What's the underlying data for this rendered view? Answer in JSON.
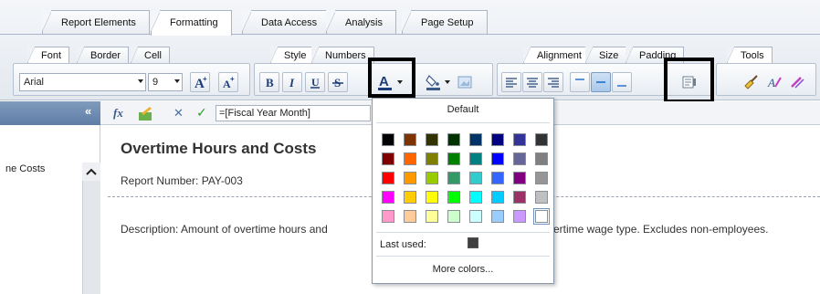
{
  "top_tabs": [
    {
      "label": "Report Elements"
    },
    {
      "label": "Formatting"
    },
    {
      "label": "Data Access"
    },
    {
      "label": "Analysis"
    },
    {
      "label": "Page Setup"
    }
  ],
  "sub_tabs": {
    "font": "Font",
    "border": "Border",
    "cell": "Cell",
    "style": "Style",
    "numbers": "Numbers",
    "alignment": "Alignment",
    "size": "Size",
    "padding": "Padding",
    "tools": "Tools"
  },
  "font_toolbar": {
    "font_name": "Arial",
    "font_size": "9"
  },
  "formula_bar": {
    "value": "=[Fiscal Year Month]"
  },
  "left_panel": {
    "item": "ne Costs"
  },
  "report": {
    "title": "Overtime Hours and Costs",
    "number": "Report Number: PAY-003",
    "description_start": "Description: Amount of overtime hours and",
    "description_end": "ertime wage type. Excludes non-employees."
  },
  "color_popup": {
    "default_label": "Default",
    "last_used_label": "Last used:",
    "more_colors_label": "More colors...",
    "swatch_rows": [
      [
        "#000000",
        "#7f3300",
        "#333300",
        "#003300",
        "#003366",
        "#000080",
        "#333399",
        "#333333"
      ],
      [
        "#800000",
        "#ff6600",
        "#808000",
        "#008000",
        "#008080",
        "#0000ff",
        "#666699",
        "#808080"
      ],
      [
        "#ff0000",
        "#ff9900",
        "#99cc00",
        "#339966",
        "#33cccc",
        "#3366ff",
        "#800080",
        "#969696"
      ],
      [
        "#ff00ff",
        "#ffcc00",
        "#ffff00",
        "#00ff00",
        "#00ffff",
        "#00ccff",
        "#993366",
        "#c0c0c0"
      ],
      [
        "#ff99cc",
        "#ffcc99",
        "#ffff99",
        "#ccffcc",
        "#ccffff",
        "#99ccff",
        "#cc99ff",
        "#ffffff"
      ]
    ],
    "last_used_color": "#3f3f3f"
  }
}
